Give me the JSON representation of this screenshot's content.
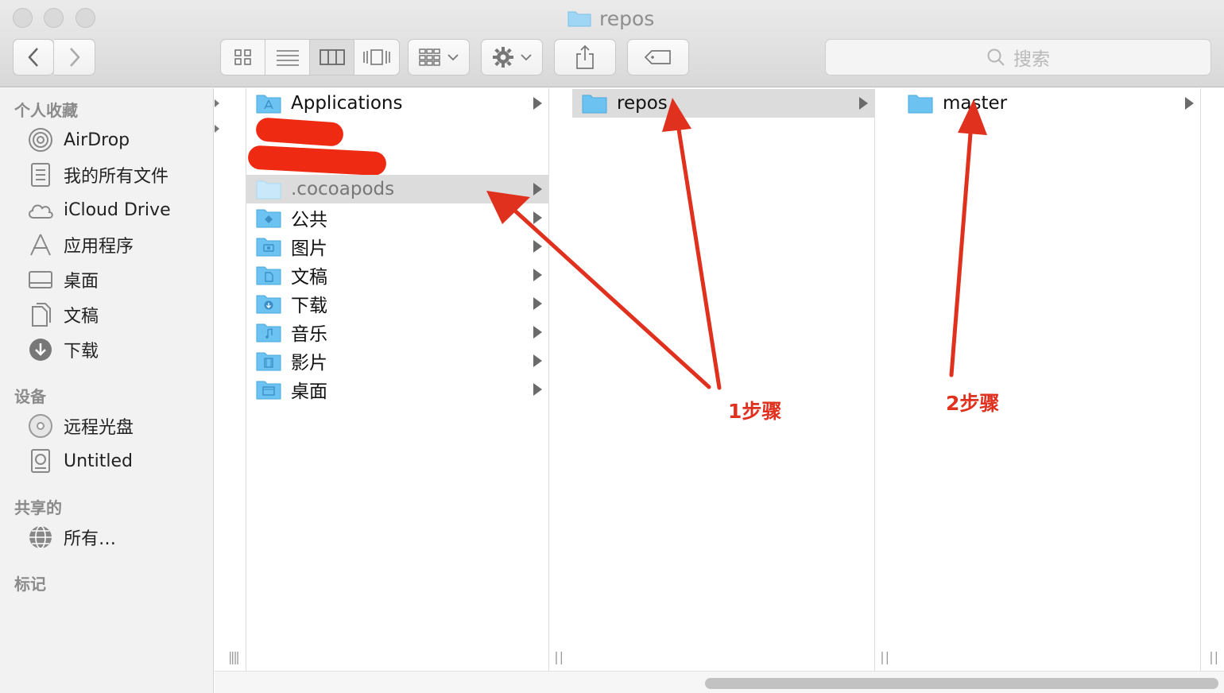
{
  "window": {
    "title": "repos"
  },
  "toolbar": {
    "search_placeholder": "搜索"
  },
  "sidebar": {
    "favorites_heading": "个人收藏",
    "favorites": [
      {
        "label": "AirDrop",
        "icon": "airdrop-icon"
      },
      {
        "label": "我的所有文件",
        "icon": "all-files-icon"
      },
      {
        "label": "iCloud Drive",
        "icon": "cloud-icon"
      },
      {
        "label": "应用程序",
        "icon": "applications-icon"
      },
      {
        "label": "桌面",
        "icon": "desktop-icon"
      },
      {
        "label": "文稿",
        "icon": "documents-icon"
      },
      {
        "label": "下载",
        "icon": "download-icon"
      }
    ],
    "devices_heading": "设备",
    "devices": [
      {
        "label": "远程光盘",
        "icon": "disc-icon"
      },
      {
        "label": "Untitled",
        "icon": "drive-icon"
      }
    ],
    "shared_heading": "共享的",
    "shared": [
      {
        "label": "所有…",
        "icon": "network-icon"
      }
    ],
    "tags_heading": "标记"
  },
  "columns": {
    "home": [
      {
        "label": "Applications"
      },
      {
        "label": ".cocoapods"
      },
      {
        "label": "公共"
      },
      {
        "label": "图片"
      },
      {
        "label": "文稿"
      },
      {
        "label": "下载"
      },
      {
        "label": "音乐"
      },
      {
        "label": "影片"
      },
      {
        "label": "桌面"
      }
    ],
    "cocoapods": [
      {
        "label": "repos"
      }
    ],
    "repos": [
      {
        "label": "master"
      }
    ]
  },
  "annotations": {
    "step1": "1步骤",
    "step2": "2步骤"
  },
  "colors": {
    "annotation_red": "#e0301e",
    "folder_blue": "#6cc3f2",
    "selection_gray": "#dcdcdc"
  }
}
